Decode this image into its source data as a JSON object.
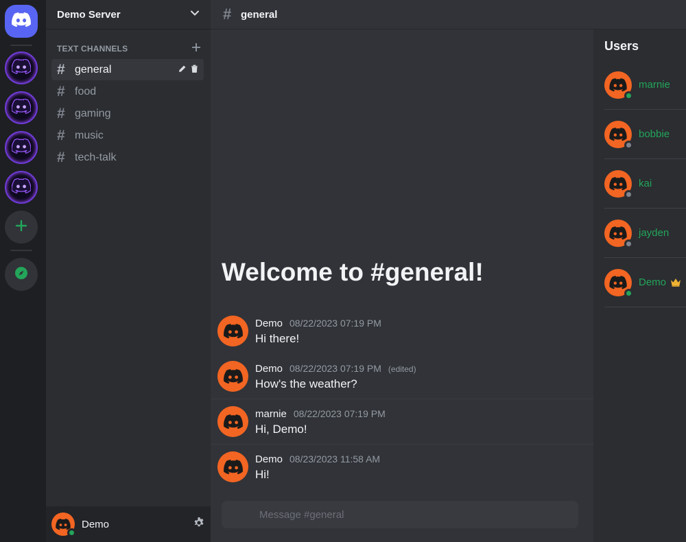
{
  "server": {
    "name": "Demo Server"
  },
  "category": {
    "label": "TEXT CHANNELS"
  },
  "channels": [
    {
      "name": "general",
      "active": true
    },
    {
      "name": "food",
      "active": false
    },
    {
      "name": "gaming",
      "active": false
    },
    {
      "name": "music",
      "active": false
    },
    {
      "name": "tech-talk",
      "active": false
    }
  ],
  "current_user": {
    "name": "Demo",
    "status": "online"
  },
  "topbar": {
    "channel_name": "general",
    "hash": "#"
  },
  "welcome": {
    "text": "Welcome to #general!"
  },
  "messages": [
    {
      "author": "Demo",
      "time": "08/22/2023 07:19 PM",
      "edited": "",
      "text": "Hi there!"
    },
    {
      "author": "Demo",
      "time": "08/22/2023 07:19 PM",
      "edited": "(edited)",
      "text": "How's the weather?"
    },
    {
      "author": "marnie",
      "time": "08/22/2023 07:19 PM",
      "edited": "",
      "text": "Hi, Demo!"
    },
    {
      "author": "Demo",
      "time": "08/23/2023 11:58 AM",
      "edited": "",
      "text": "Hi!"
    }
  ],
  "composer": {
    "placeholder": "Message #general"
  },
  "users_panel": {
    "title": "Users",
    "users": [
      {
        "name": "marnie",
        "status": "online",
        "owner": false
      },
      {
        "name": "bobbie",
        "status": "offline",
        "owner": false
      },
      {
        "name": "kai",
        "status": "offline",
        "owner": false
      },
      {
        "name": "jayden",
        "status": "offline",
        "owner": false
      },
      {
        "name": "Demo",
        "status": "online",
        "owner": true
      }
    ]
  },
  "icons": {
    "home": "discord-logo-icon",
    "servers": [
      "server-icon",
      "server-icon",
      "server-icon",
      "server-icon"
    ],
    "add_server": "plus-icon",
    "explore": "compass-icon",
    "dropdown": "chevron-down-icon",
    "add_channel": "plus-icon",
    "channel": "hash-icon",
    "edit": "pencil-icon",
    "delete": "trash-icon",
    "settings": "gear-icon",
    "owner": "crown-icon"
  },
  "colors": {
    "brand": "#5865f2",
    "online": "#23a55a",
    "offline": "#80848e",
    "avatar": "#f26522",
    "username": "#23a55a",
    "crown": "#f0b232"
  }
}
